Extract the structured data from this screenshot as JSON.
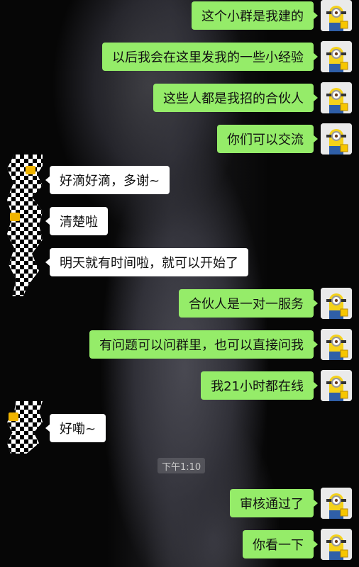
{
  "chat": {
    "messages": [
      {
        "side": "me",
        "text": "这个小群是我建的"
      },
      {
        "side": "me",
        "text": "以后我会在这里发我的一些小经验"
      },
      {
        "side": "me",
        "text": "这些人都是我招的合伙人"
      },
      {
        "side": "me",
        "text": "你们可以交流"
      },
      {
        "side": "other",
        "text": "好滴好滴，多谢~"
      },
      {
        "side": "other",
        "text": "清楚啦"
      },
      {
        "side": "other",
        "text": "明天就有时间啦，就可以开始了"
      },
      {
        "side": "me",
        "text": "合伙人是一对一服务"
      },
      {
        "side": "me",
        "text": "有问题可以问群里，也可以直接问我"
      },
      {
        "side": "me",
        "text": "我21小时都在线"
      },
      {
        "side": "other",
        "text": "好嘞~"
      },
      {
        "side": "me",
        "text": "审核通过了"
      },
      {
        "side": "me",
        "text": "你看一下"
      }
    ],
    "timestamp": "下午1:10"
  },
  "colors": {
    "my_bubble": "#95ec69",
    "other_bubble": "#ffffff",
    "minion_yellow": "#f5d21a",
    "background": "#050505"
  },
  "avatars": {
    "me_icon": "minion-avatar-icon",
    "other_icon": "houndstooth-avatar-icon"
  }
}
